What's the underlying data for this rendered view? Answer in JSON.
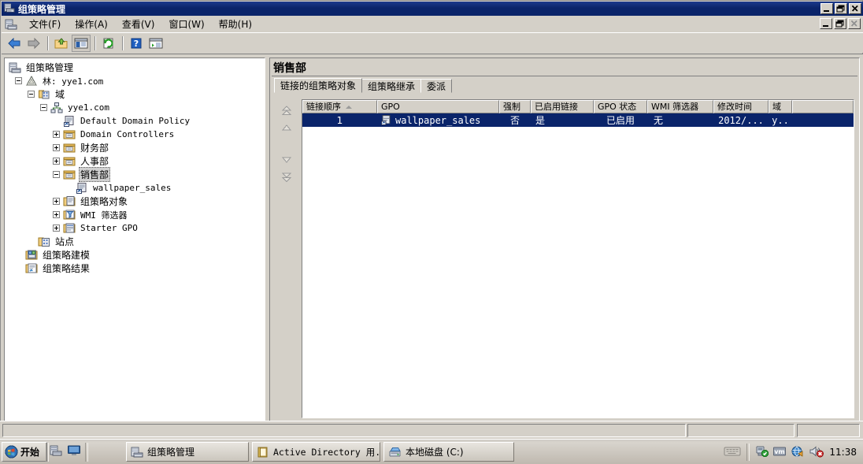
{
  "window": {
    "title": "组策略管理",
    "minimize_label": "_",
    "maximize_label": "❐",
    "close_label": "✕"
  },
  "menubar": {
    "items": [
      {
        "label": "文件(F)"
      },
      {
        "label": "操作(A)"
      },
      {
        "label": "查看(V)"
      },
      {
        "label": "窗口(W)"
      },
      {
        "label": "帮助(H)"
      }
    ]
  },
  "toolbar": {
    "buttons": [
      {
        "name": "back-icon",
        "tip": "后退"
      },
      {
        "name": "forward-icon",
        "tip": "前进"
      },
      {
        "name": "up-folder-icon",
        "tip": "上一级"
      },
      {
        "name": "show-tree-icon",
        "tip": "显示/隐藏控制台树"
      },
      {
        "name": "refresh-icon",
        "tip": "刷新"
      },
      {
        "name": "help-icon",
        "tip": "帮助"
      },
      {
        "name": "properties-icon",
        "tip": "属性"
      }
    ]
  },
  "tree": {
    "nodes": [
      {
        "label": "组策略管理",
        "indent": 0,
        "expander": "none",
        "icon": "gpmc-icon",
        "selected": false,
        "mono": false
      },
      {
        "label": "林: yye1.com",
        "indent": 1,
        "expander": "minus",
        "icon": "forest-icon",
        "selected": false,
        "mono": false
      },
      {
        "label": "域",
        "indent": 2,
        "expander": "minus",
        "icon": "domains-icon",
        "selected": false,
        "mono": false
      },
      {
        "label": "yye1.com",
        "indent": 3,
        "expander": "minus",
        "icon": "domain-icon",
        "selected": false,
        "mono": true
      },
      {
        "label": "Default Domain Policy",
        "indent": 4,
        "expander": "none",
        "icon": "gpo-link-icon",
        "selected": false,
        "mono": true
      },
      {
        "label": "Domain Controllers",
        "indent": 4,
        "expander": "plus",
        "icon": "ou-icon",
        "selected": false,
        "mono": true
      },
      {
        "label": "财务部",
        "indent": 4,
        "expander": "plus",
        "icon": "ou-icon",
        "selected": false,
        "mono": false
      },
      {
        "label": "人事部",
        "indent": 4,
        "expander": "plus",
        "icon": "ou-icon",
        "selected": false,
        "mono": false
      },
      {
        "label": "销售部",
        "indent": 4,
        "expander": "minus",
        "icon": "ou-icon",
        "selected": true,
        "mono": false
      },
      {
        "label": "wallpaper_sales",
        "indent": 5,
        "expander": "none",
        "icon": "gpo-link-icon",
        "selected": false,
        "mono": true
      },
      {
        "label": "组策略对象",
        "indent": 4,
        "expander": "plus",
        "icon": "gpo-folder-icon",
        "selected": false,
        "mono": false
      },
      {
        "label": "WMI 筛选器",
        "indent": 4,
        "expander": "plus",
        "icon": "wmi-filter-icon",
        "selected": false,
        "mono": true
      },
      {
        "label": "Starter GPO",
        "indent": 4,
        "expander": "plus",
        "icon": "starter-gpo-icon",
        "selected": false,
        "mono": true
      },
      {
        "label": "站点",
        "indent": 2,
        "expander": "none",
        "icon": "sites-icon",
        "selected": false,
        "mono": false
      },
      {
        "label": "组策略建模",
        "indent": 1,
        "expander": "none",
        "icon": "modeling-icon",
        "selected": false,
        "mono": false
      },
      {
        "label": "组策略结果",
        "indent": 1,
        "expander": "none",
        "icon": "results-icon",
        "selected": false,
        "mono": false
      }
    ]
  },
  "detail": {
    "title": "销售部",
    "tabs": [
      {
        "label": "链接的组策略对象",
        "active": true
      },
      {
        "label": "组策略继承",
        "active": false
      },
      {
        "label": "委派",
        "active": false
      }
    ],
    "order_buttons": [
      {
        "name": "move-to-top-button",
        "tip": "移到最上"
      },
      {
        "name": "move-up-button",
        "tip": "上移"
      },
      {
        "name": "move-down-button",
        "tip": "下移"
      },
      {
        "name": "move-to-bottom-button",
        "tip": "移到最下"
      }
    ],
    "table": {
      "columns": [
        {
          "label": "链接顺序",
          "width": 95,
          "sorted": true,
          "align": "center"
        },
        {
          "label": "GPO",
          "width": 155,
          "sorted": false,
          "align": "left"
        },
        {
          "label": "强制",
          "width": 40,
          "sorted": false,
          "align": "center"
        },
        {
          "label": "已启用链接",
          "width": 80,
          "sorted": false,
          "align": "center"
        },
        {
          "label": "GPO 状态",
          "width": 68,
          "sorted": false,
          "align": "center"
        },
        {
          "label": "WMI 筛选器",
          "width": 84,
          "sorted": false,
          "align": "center"
        },
        {
          "label": "修改时间",
          "width": 70,
          "sorted": false,
          "align": "center"
        },
        {
          "label": "域",
          "width": 30,
          "sorted": false,
          "align": "center"
        },
        {
          "label": "",
          "width": 78,
          "sorted": false,
          "align": "left"
        }
      ],
      "rows": [
        {
          "selected": true,
          "cells": [
            "1",
            "wallpaper_sales",
            "否",
            "是",
            "已启用",
            "无",
            "2012/...",
            "y..",
            ""
          ]
        }
      ]
    }
  },
  "statusbar": {
    "panes": [
      "",
      "",
      ""
    ]
  },
  "taskbar": {
    "start_label": "开始",
    "quicklaunch": [
      {
        "name": "server-manager-icon"
      },
      {
        "name": "show-desktop-icon"
      }
    ],
    "tasks": [
      {
        "label": "组策略管理",
        "icon": "gpmc-icon",
        "active": true
      },
      {
        "label": "Active Directory 用...",
        "icon": "adsi-icon",
        "active": false
      },
      {
        "label": "本地磁盘 (C:)",
        "icon": "explorer-icon",
        "active": false
      }
    ],
    "tray": {
      "icons": [
        {
          "name": "keyboard-layout-icon"
        },
        {
          "name": "network-ok-icon"
        },
        {
          "name": "vm-tools-icon"
        },
        {
          "name": "windows-update-icon"
        },
        {
          "name": "volume-muted-icon"
        }
      ],
      "clock": "11:38"
    }
  },
  "colors": {
    "title_bar": "#0a246a",
    "face": "#d4d0c8",
    "selection": "#0a246a",
    "selection_text": "#ffffff",
    "tree_select_bg": "#d0d0d0"
  }
}
